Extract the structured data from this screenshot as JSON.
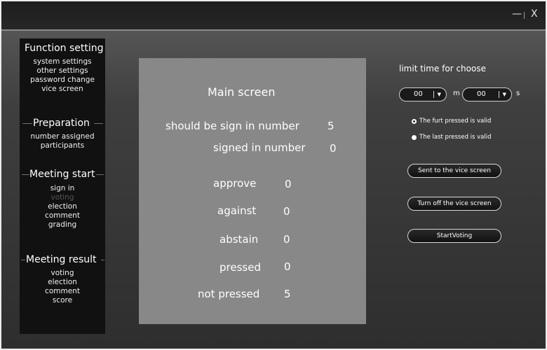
{
  "window": {
    "minimize_label": "—",
    "close_label": "X"
  },
  "sidebar": {
    "sections": [
      {
        "title": "Function setting",
        "items": [
          "system settings",
          "other settings",
          "password change",
          "vice screen"
        ]
      },
      {
        "title": "Preparation",
        "items": [
          "number assigned",
          "participants"
        ]
      },
      {
        "title": "Meeting start",
        "items": [
          "sign in",
          "voting",
          "election",
          "comment",
          "grading"
        ]
      },
      {
        "title": "Meeting result",
        "items": [
          "voting",
          "election",
          "comment",
          "score"
        ]
      }
    ]
  },
  "main": {
    "title": "Main screen",
    "should_sign_label": "should be sign in number",
    "should_sign_value": "5",
    "signed_label": "signed in number",
    "signed_value": "0",
    "rows": [
      {
        "label": "approve",
        "value": "0"
      },
      {
        "label": "against",
        "value": "0"
      },
      {
        "label": "abstain",
        "value": "0"
      },
      {
        "label": "pressed",
        "value": "0"
      },
      {
        "label": "not pressed",
        "value": "5"
      }
    ]
  },
  "right": {
    "limit_label": "limit time for choose",
    "minutes_value": "00",
    "minutes_unit": "m",
    "seconds_value": "00",
    "seconds_unit": "s",
    "arrow": "▼",
    "radio_first": "The furt pressed is valid",
    "radio_last": "The last pressed is valid",
    "selected_option": "The furt pressed is valid",
    "btn_send": "Sent to the vice screen",
    "btn_off": "Turn off the vice screen",
    "btn_start": "StartVoting"
  }
}
